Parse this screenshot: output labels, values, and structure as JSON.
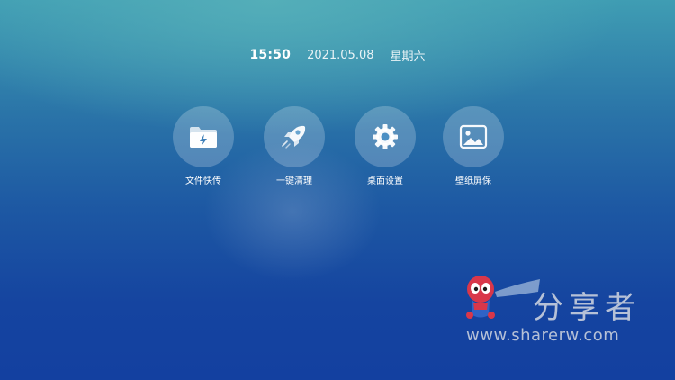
{
  "status": {
    "time": "15:50",
    "date": "2021.05.08",
    "weekday": "星期六"
  },
  "apps": [
    {
      "label": "文件快传",
      "icon": "folder-icon"
    },
    {
      "label": "一键清理",
      "icon": "rocket-icon"
    },
    {
      "label": "桌面设置",
      "icon": "gear-icon"
    },
    {
      "label": "壁纸屏保",
      "icon": "image-icon"
    }
  ],
  "watermark": {
    "name": "分享者",
    "url": "www.sharerw.com"
  }
}
